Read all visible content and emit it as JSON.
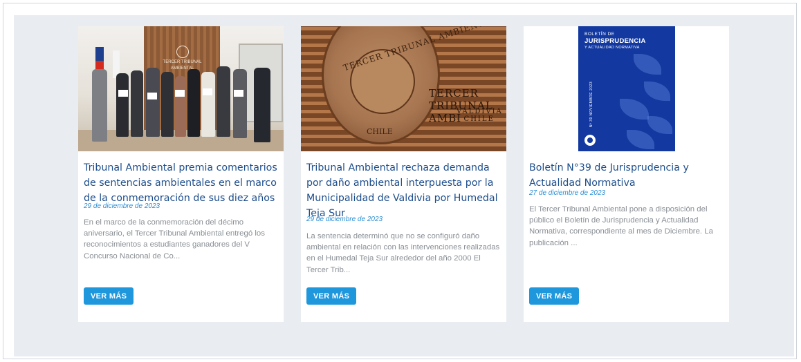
{
  "cards": [
    {
      "title": "Tribunal Ambiental premia comentarios de sentencias ambientales en el marco de la conmemoración de sus diez años",
      "date": "29 de diciembre de 2023",
      "excerpt": "En el marco de la conmemoración del décimo aniversario, el Tercer Tribunal Ambiental entregó los reconocimientos a estudiantes ganadores del V Concurso Nacional de Co...",
      "button": "VER MÁS",
      "image_sign": "TERCER TRIBUNAL AMBIENTAL"
    },
    {
      "title": "Tribunal Ambiental rechaza demanda por daño ambiental interpuesta por la Municipalidad de Valdivia por Humedal Teja Sur",
      "date": "29 de diciembre de 2023",
      "excerpt": "La sentencia determinó que no se configuró daño ambiental en relación con las intervenciones realizadas en el Humedal Teja Sur alrededor del año 2000 El Tercer Trib...",
      "button": "VER MÁS",
      "image_seal_top": "TERCER TRIBUNAL AMBIENTAL",
      "image_seal_bottom": "CHILE",
      "image_label": "TERCER TRIBUNAL AMBI",
      "image_label_2": "VALDIVIA - CHILE"
    },
    {
      "title": "Boletín N°39 de Jurisprudencia y Actualidad Normativa",
      "date": "27 de diciembre de 2023",
      "excerpt": "El Tercer Tribunal Ambiental pone a disposición del público el Boletín de Jurisprudencia y Actualidad Normativa, correspondiente al mes de Diciembre. La publicación ...",
      "button": "VER MÁS",
      "cover_line1": "BOLETÍN DE",
      "cover_line2": "JURISPRUDENCIA",
      "cover_line3": "Y ACTUALIDAD NORMATIVA",
      "cover_vertical": "Nº 39 NOVIEMBRE 2023"
    }
  ],
  "colors": {
    "title": "#1d4e8c",
    "date": "#2a8fd6",
    "button": "#1e97dc",
    "panel": "#e9edf2",
    "cover": "#1339a0"
  },
  "icons": [
    "court-emblem-icon"
  ]
}
